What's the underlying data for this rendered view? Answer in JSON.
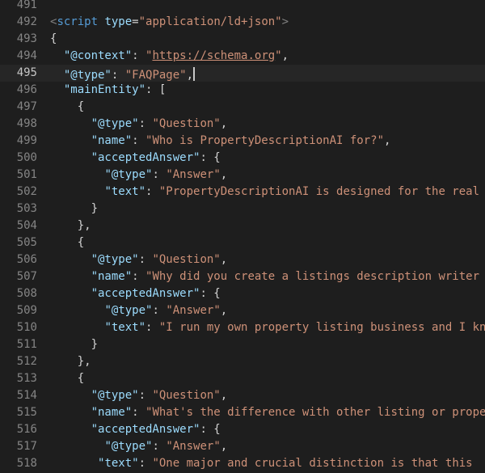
{
  "editor": {
    "background_color": "#1e1e1e",
    "gutter_color": "#858585",
    "active_gutter_color": "#c6c6c6",
    "key_color": "#9cdcfe",
    "string_color": "#ce9178",
    "punctuation_color": "#d4d4d4",
    "tag_color": "#569cd6",
    "angle_bracket_color": "#808080",
    "cursor_line": 495,
    "lines": [
      {
        "num": 491,
        "tokens": []
      },
      {
        "num": 492,
        "tokens": [
          {
            "t": "<",
            "c": "ab"
          },
          {
            "t": "script",
            "c": "tag"
          },
          {
            "t": " ",
            "c": "ws"
          },
          {
            "t": "type",
            "c": "attr"
          },
          {
            "t": "=",
            "c": "p"
          },
          {
            "t": "\"application/ld+json\"",
            "c": "s"
          },
          {
            "t": ">",
            "c": "ab"
          }
        ]
      },
      {
        "num": 493,
        "tokens": [
          {
            "t": "{",
            "c": "p"
          }
        ]
      },
      {
        "num": 494,
        "tokens": [
          {
            "t": "  ",
            "c": "ws"
          },
          {
            "t": "\"@context\"",
            "c": "k"
          },
          {
            "t": ": ",
            "c": "p"
          },
          {
            "t": "\"",
            "c": "s"
          },
          {
            "t": "https://schema.org",
            "c": "link"
          },
          {
            "t": "\"",
            "c": "s"
          },
          {
            "t": ",",
            "c": "p"
          }
        ]
      },
      {
        "num": 495,
        "cursor": true,
        "tokens": [
          {
            "t": "  ",
            "c": "ws"
          },
          {
            "t": "\"@type\"",
            "c": "k"
          },
          {
            "t": ": ",
            "c": "p"
          },
          {
            "t": "\"FAQPage\"",
            "c": "s"
          },
          {
            "t": ",",
            "c": "p"
          }
        ]
      },
      {
        "num": 496,
        "tokens": [
          {
            "t": "  ",
            "c": "ws"
          },
          {
            "t": "\"mainEntity\"",
            "c": "k"
          },
          {
            "t": ": [",
            "c": "p"
          }
        ]
      },
      {
        "num": 497,
        "tokens": [
          {
            "t": "    ",
            "c": "ws"
          },
          {
            "t": "{",
            "c": "p"
          }
        ]
      },
      {
        "num": 498,
        "tokens": [
          {
            "t": "      ",
            "c": "ws"
          },
          {
            "t": "\"@type\"",
            "c": "k"
          },
          {
            "t": ": ",
            "c": "p"
          },
          {
            "t": "\"Question\"",
            "c": "s"
          },
          {
            "t": ",",
            "c": "p"
          }
        ]
      },
      {
        "num": 499,
        "tokens": [
          {
            "t": "      ",
            "c": "ws"
          },
          {
            "t": "\"name\"",
            "c": "k"
          },
          {
            "t": ": ",
            "c": "p"
          },
          {
            "t": "\"Who is PropertyDescriptionAI for?\"",
            "c": "s"
          },
          {
            "t": ",",
            "c": "p"
          }
        ]
      },
      {
        "num": 500,
        "tokens": [
          {
            "t": "      ",
            "c": "ws"
          },
          {
            "t": "\"acceptedAnswer\"",
            "c": "k"
          },
          {
            "t": ": {",
            "c": "p"
          }
        ]
      },
      {
        "num": 501,
        "tokens": [
          {
            "t": "        ",
            "c": "ws"
          },
          {
            "t": "\"@type\"",
            "c": "k"
          },
          {
            "t": ": ",
            "c": "p"
          },
          {
            "t": "\"Answer\"",
            "c": "s"
          },
          {
            "t": ",",
            "c": "p"
          }
        ]
      },
      {
        "num": 502,
        "tokens": [
          {
            "t": "        ",
            "c": "ws"
          },
          {
            "t": "\"text\"",
            "c": "k"
          },
          {
            "t": ": ",
            "c": "p"
          },
          {
            "t": "\"PropertyDescriptionAI is designed for the real",
            "c": "s"
          }
        ]
      },
      {
        "num": 503,
        "tokens": [
          {
            "t": "      ",
            "c": "ws"
          },
          {
            "t": "}",
            "c": "p"
          }
        ]
      },
      {
        "num": 504,
        "tokens": [
          {
            "t": "    ",
            "c": "ws"
          },
          {
            "t": "},",
            "c": "p"
          }
        ]
      },
      {
        "num": 505,
        "tokens": [
          {
            "t": "    ",
            "c": "ws"
          },
          {
            "t": "{",
            "c": "p"
          }
        ]
      },
      {
        "num": 506,
        "tokens": [
          {
            "t": "      ",
            "c": "ws"
          },
          {
            "t": "\"@type\"",
            "c": "k"
          },
          {
            "t": ": ",
            "c": "p"
          },
          {
            "t": "\"Question\"",
            "c": "s"
          },
          {
            "t": ",",
            "c": "p"
          }
        ]
      },
      {
        "num": 507,
        "tokens": [
          {
            "t": "      ",
            "c": "ws"
          },
          {
            "t": "\"name\"",
            "c": "k"
          },
          {
            "t": ": ",
            "c": "p"
          },
          {
            "t": "\"Why did you create a listings description writer",
            "c": "s"
          }
        ]
      },
      {
        "num": 508,
        "tokens": [
          {
            "t": "      ",
            "c": "ws"
          },
          {
            "t": "\"acceptedAnswer\"",
            "c": "k"
          },
          {
            "t": ": {",
            "c": "p"
          }
        ]
      },
      {
        "num": 509,
        "tokens": [
          {
            "t": "        ",
            "c": "ws"
          },
          {
            "t": "\"@type\"",
            "c": "k"
          },
          {
            "t": ": ",
            "c": "p"
          },
          {
            "t": "\"Answer\"",
            "c": "s"
          },
          {
            "t": ",",
            "c": "p"
          }
        ]
      },
      {
        "num": 510,
        "tokens": [
          {
            "t": "        ",
            "c": "ws"
          },
          {
            "t": "\"text\"",
            "c": "k"
          },
          {
            "t": ": ",
            "c": "p"
          },
          {
            "t": "\"I run my own property listing business and I kn",
            "c": "s"
          }
        ]
      },
      {
        "num": 511,
        "tokens": [
          {
            "t": "      ",
            "c": "ws"
          },
          {
            "t": "}",
            "c": "p"
          }
        ]
      },
      {
        "num": 512,
        "tokens": [
          {
            "t": "    ",
            "c": "ws"
          },
          {
            "t": "},",
            "c": "p"
          }
        ]
      },
      {
        "num": 513,
        "tokens": [
          {
            "t": "    ",
            "c": "ws"
          },
          {
            "t": "{",
            "c": "p"
          }
        ]
      },
      {
        "num": 514,
        "tokens": [
          {
            "t": "      ",
            "c": "ws"
          },
          {
            "t": "\"@type\"",
            "c": "k"
          },
          {
            "t": ": ",
            "c": "p"
          },
          {
            "t": "\"Question\"",
            "c": "s"
          },
          {
            "t": ",",
            "c": "p"
          }
        ]
      },
      {
        "num": 515,
        "tokens": [
          {
            "t": "      ",
            "c": "ws"
          },
          {
            "t": "\"name\"",
            "c": "k"
          },
          {
            "t": ": ",
            "c": "p"
          },
          {
            "t": "\"What's the difference with other listing or prope",
            "c": "s"
          }
        ]
      },
      {
        "num": 516,
        "tokens": [
          {
            "t": "      ",
            "c": "ws"
          },
          {
            "t": "\"acceptedAnswer\"",
            "c": "k"
          },
          {
            "t": ": {",
            "c": "p"
          }
        ]
      },
      {
        "num": 517,
        "tokens": [
          {
            "t": "        ",
            "c": "ws"
          },
          {
            "t": "\"@type\"",
            "c": "k"
          },
          {
            "t": ": ",
            "c": "p"
          },
          {
            "t": "\"Answer\"",
            "c": "s"
          },
          {
            "t": ",",
            "c": "p"
          }
        ]
      },
      {
        "num": 518,
        "tokens": [
          {
            "t": "       ",
            "c": "ws"
          },
          {
            "t": "\"text\"",
            "c": "k"
          },
          {
            "t": ": ",
            "c": "p"
          },
          {
            "t": "\"One major and crucial distinction is that this",
            "c": "s"
          }
        ]
      }
    ]
  }
}
